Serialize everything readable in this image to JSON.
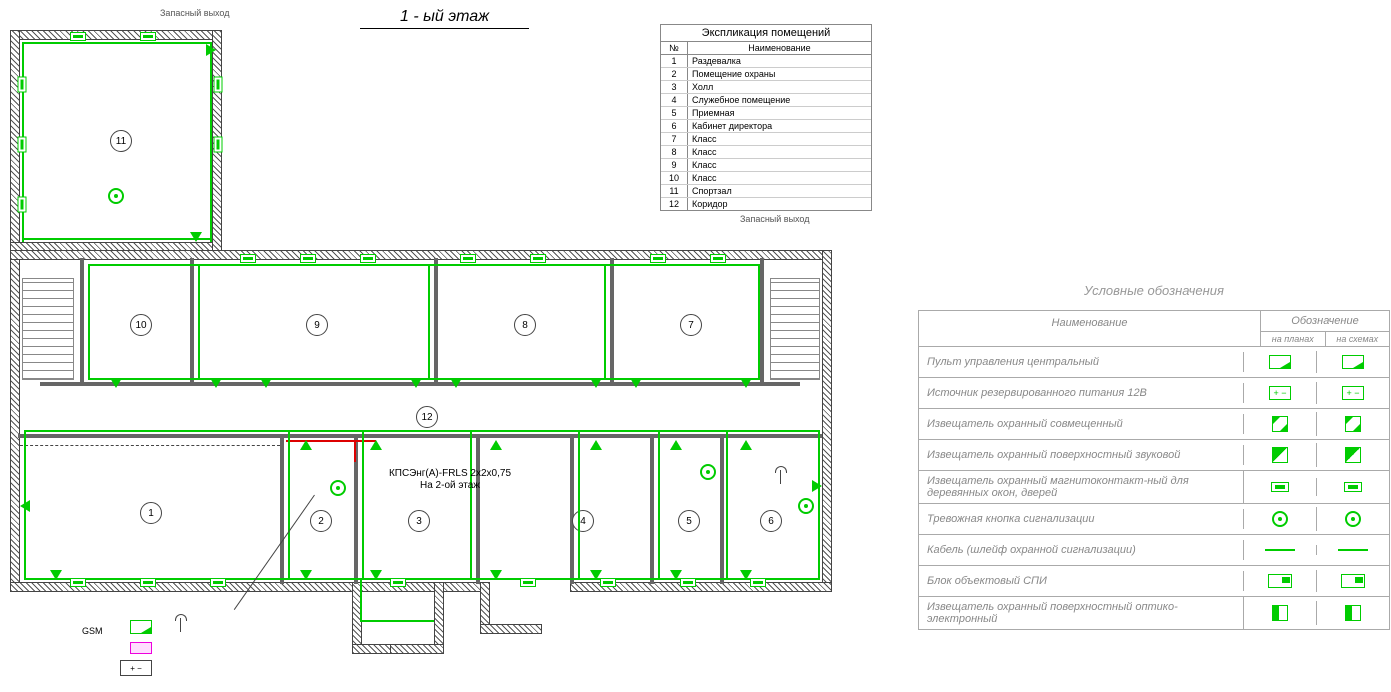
{
  "title": "1 - ый этаж",
  "exits": {
    "left": "Запасный выход",
    "right": "Запасный выход"
  },
  "explication": {
    "title": "Экспликация помещений",
    "header_num": "№",
    "header_name": "Наименование",
    "rows": [
      {
        "n": "1",
        "name": "Раздевалка"
      },
      {
        "n": "2",
        "name": "Помещение охраны"
      },
      {
        "n": "3",
        "name": "Холл"
      },
      {
        "n": "4",
        "name": "Служебное помещение"
      },
      {
        "n": "5",
        "name": "Приемная"
      },
      {
        "n": "6",
        "name": "Кабинет директора"
      },
      {
        "n": "7",
        "name": "Класс"
      },
      {
        "n": "8",
        "name": "Класс"
      },
      {
        "n": "9",
        "name": "Класс"
      },
      {
        "n": "10",
        "name": "Класс"
      },
      {
        "n": "11",
        "name": "Спортзал"
      },
      {
        "n": "12",
        "name": "Коридор"
      }
    ]
  },
  "cable_label": {
    "line1": "КПСЭнг(А)-FRLS 2х2х0,75",
    "line2": "На 2-ой этаж"
  },
  "gsm": "GSM",
  "legend": {
    "title": "Условные обозначения",
    "header_name": "Наименование",
    "header_sym": "Обозначение",
    "header_sub1": "на планах",
    "header_sub2": "на схемах",
    "rows": [
      {
        "name": "Пульт управления центральный",
        "sym": "panel"
      },
      {
        "name": "Источник резервированного питания 12В",
        "sym": "psu"
      },
      {
        "name": "Извещатель охранный совмещенный",
        "sym": "detector"
      },
      {
        "name": "Извещатель охранный поверхностный звуковой",
        "sym": "sound"
      },
      {
        "name": "Извещатель охранный магнитоконтакт-ный для деревянных окон, дверей",
        "sym": "magnet"
      },
      {
        "name": "Тревожная кнопка сигнализации",
        "sym": "button"
      },
      {
        "name": "Кабель (шлейф охранной сигнализации)",
        "sym": "cable"
      },
      {
        "name": "Блок объектовый СПИ",
        "sym": "spi"
      },
      {
        "name": "Извещатель охранный поверхностный оптико-электронный",
        "sym": "optic"
      }
    ]
  },
  "rooms": [
    "1",
    "2",
    "3",
    "4",
    "5",
    "6",
    "7",
    "8",
    "9",
    "10",
    "11",
    "12"
  ]
}
